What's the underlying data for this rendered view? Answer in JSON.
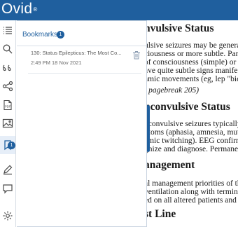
{
  "header": {
    "brand": "Ovid",
    "brand_mark": "®",
    "bg_color": "#1f5f9e"
  },
  "rail": {
    "icons": [
      "list-icon",
      "search-icon",
      "quote-icon",
      "share-icon",
      "pdf-icon",
      "image-icon",
      "bookmark-icon",
      "pen-icon",
      "comment-icon",
      "settings-icon"
    ],
    "bookmark_badge": "1"
  },
  "bookmarks_panel": {
    "title": "Bookmarks",
    "count": "1",
    "items": [
      {
        "title": "130: Status Epilepticus: The Most Co...",
        "timestamp": "2:49 PM 18 Nov 2021"
      }
    ]
  },
  "document": {
    "heading_1": "nvulsive Status",
    "p1": [
      "ulsive seizures may be generaliz",
      "ciousness or more subtle. Partial",
      "of consciousness (simple) or alte",
      "ave quite subtle signs manifeste",
      "amic movements (eg, lep \"bicycl"
    ],
    "pagebreak": "t pagebreak 205)",
    "heading_2": "nconvulsive Status",
    "p2": [
      "nconvulsive seizures typically ma",
      "ptoms (aphasia, amnesia, mutism",
      "amic twitching). EEG confirms c",
      "gnize and diagnose. Permanent s"
    ],
    "heading_3": "anagement",
    "p3": [
      "al management priorities of the p",
      "ventilation along with terminatio",
      "ed on all altered patients and th"
    ],
    "heading_4": "st Line"
  }
}
